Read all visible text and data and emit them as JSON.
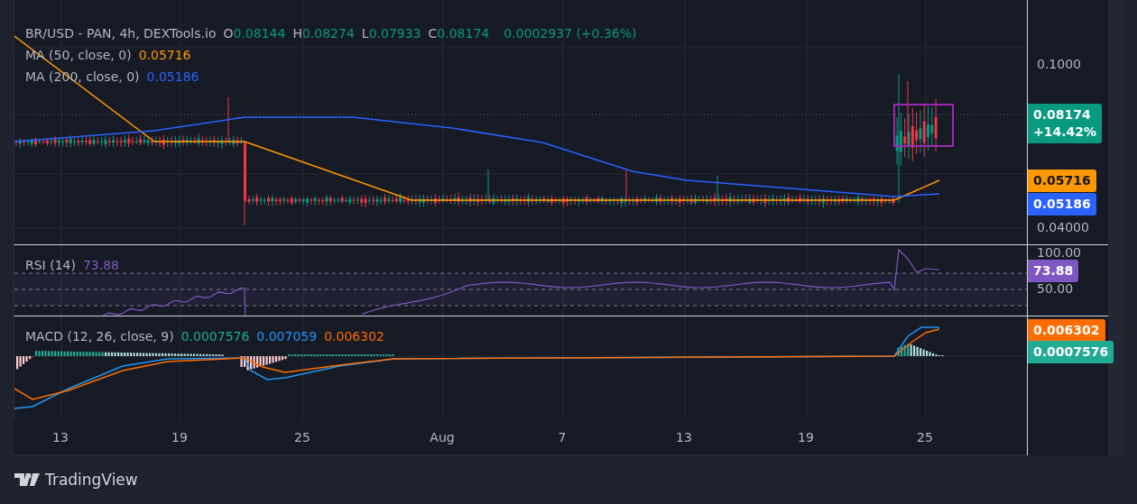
{
  "legend": {
    "symbol": "BR/USD - PAN, 4h, DEXTools.io",
    "ohlc": [
      {
        "label": "O",
        "value": "0.08144"
      },
      {
        "label": "H",
        "value": "0.08274"
      },
      {
        "label": "L",
        "value": "0.07933"
      },
      {
        "label": "C",
        "value": "0.08174"
      }
    ],
    "change": "0.0002937 (+0.36%)"
  },
  "moving_averages": [
    {
      "label": "MA (50, close, 0)",
      "value": "0.05716",
      "color": "#ff9800"
    },
    {
      "label": "MA (200, close, 0)",
      "value": "0.05186",
      "color": "#2962ff"
    }
  ],
  "price_axis": [
    "0.1000",
    "0.04000"
  ],
  "price_tags": [
    {
      "kind": "last",
      "value": "0.08174",
      "change": "+14.42%",
      "color": "#089981"
    },
    {
      "kind": "ma",
      "value": "0.05716",
      "color": "#ff9800"
    },
    {
      "kind": "ma",
      "value": "0.05186",
      "color": "#2962ff"
    }
  ],
  "rsi": {
    "label": "RSI (14)",
    "value": "73.88",
    "axis": [
      "100.00",
      "50.00"
    ],
    "tag": "73.88"
  },
  "macd": {
    "label": "MACD (12, 26, close, 9)",
    "values": [
      {
        "value": "0.0007576",
        "color": "#22ab94"
      },
      {
        "value": "0.007059",
        "color": "#2196f3"
      },
      {
        "value": "0.006302",
        "color": "#ff6d00"
      }
    ],
    "tags": [
      {
        "value": "0.006302",
        "color": "#ff6d00"
      },
      {
        "value": "0.0007576",
        "color": "#22ab94"
      }
    ]
  },
  "time_axis": [
    "13",
    "19",
    "25",
    "Aug",
    "7",
    "13",
    "19",
    "25"
  ],
  "branding": "TradingView"
}
